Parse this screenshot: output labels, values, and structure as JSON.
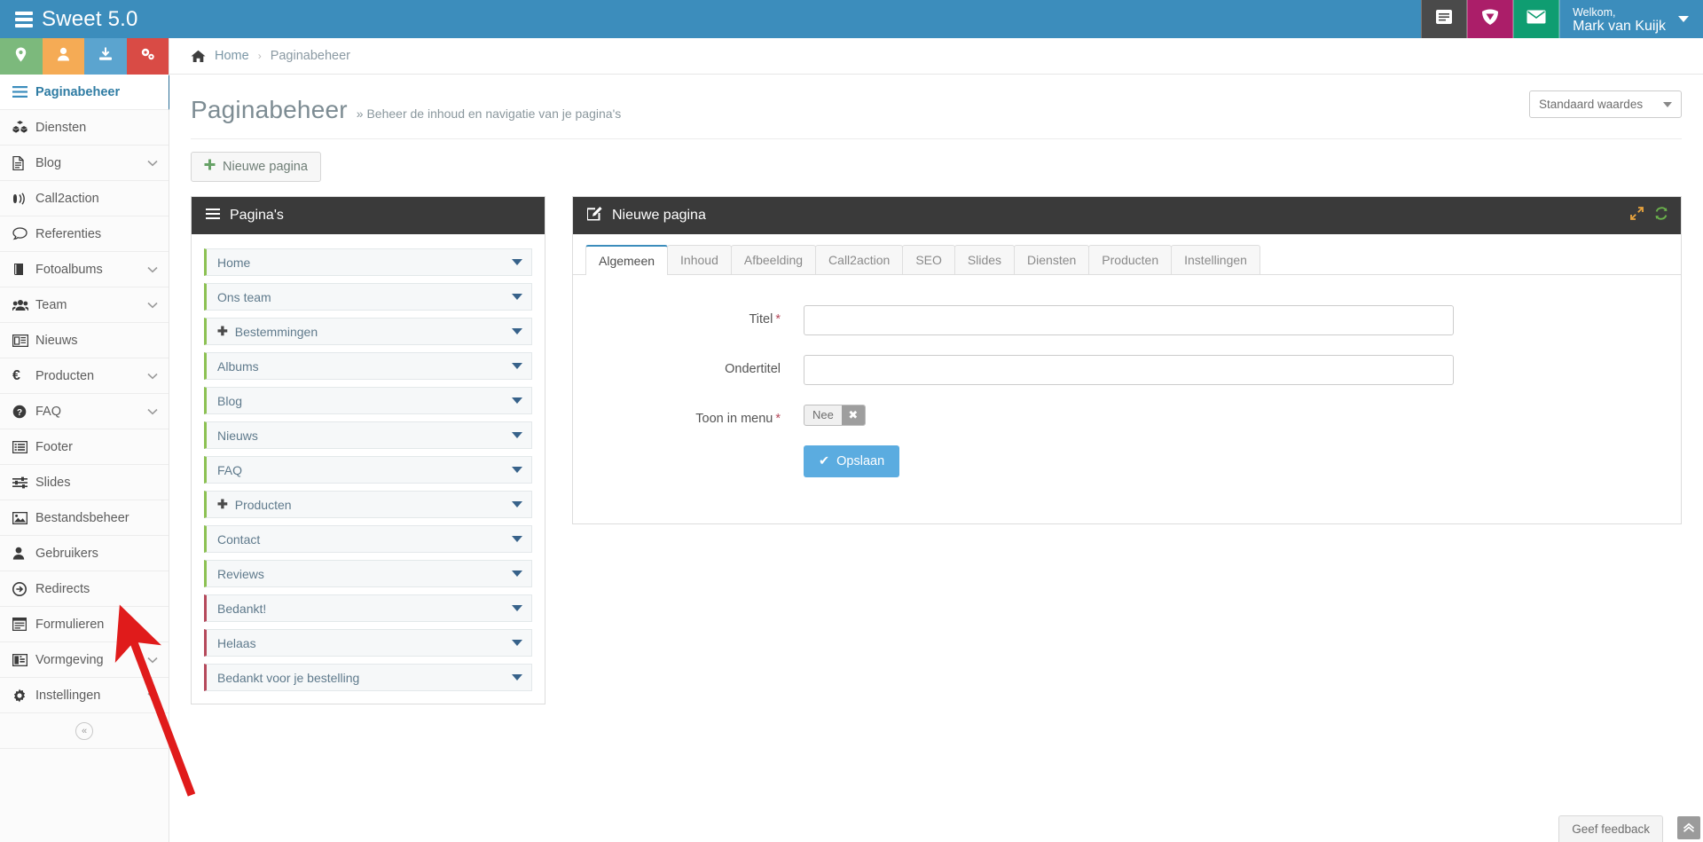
{
  "topbar": {
    "brand": "Sweet 5.0",
    "brand_icon": "server-stack-icon",
    "actions": [
      {
        "name": "list-icon",
        "glyph": "☰"
      },
      {
        "name": "diamond-superhero-icon",
        "glyph": "◇"
      },
      {
        "name": "envelope-icon",
        "glyph": "✉"
      }
    ],
    "user": {
      "greeting": "Welkom,",
      "name": "Mark van Kuijk"
    }
  },
  "quickbar": [
    {
      "name": "map-marker-icon",
      "glyph": "⌘",
      "color": "#7cb97c"
    },
    {
      "name": "user-icon",
      "glyph": "☺",
      "color": "#f5ab55"
    },
    {
      "name": "download-icon",
      "glyph": "⤓",
      "color": "#5ba4cf"
    },
    {
      "name": "cogs-icon",
      "glyph": "⚙",
      "color": "#d94b45"
    }
  ],
  "sidebar": {
    "items": [
      {
        "label": "Paginabeheer",
        "icon": "bars-icon",
        "active": true,
        "chevron": false
      },
      {
        "label": "Diensten",
        "icon": "cubes-icon",
        "active": false,
        "chevron": false
      },
      {
        "label": "Blog",
        "icon": "file-text-icon",
        "active": false,
        "chevron": true
      },
      {
        "label": "Call2action",
        "icon": "bullhorn-icon",
        "active": false,
        "chevron": false
      },
      {
        "label": "Referenties",
        "icon": "comment-icon",
        "active": false,
        "chevron": false
      },
      {
        "label": "Fotoalbums",
        "icon": "book-icon",
        "active": false,
        "chevron": true
      },
      {
        "label": "Team",
        "icon": "users-icon",
        "active": false,
        "chevron": true
      },
      {
        "label": "Nieuws",
        "icon": "newspaper-icon",
        "active": false,
        "chevron": false
      },
      {
        "label": "Producten",
        "icon": "euro-icon",
        "active": false,
        "chevron": true
      },
      {
        "label": "FAQ",
        "icon": "question-circle-icon",
        "active": false,
        "chevron": true
      },
      {
        "label": "Footer",
        "icon": "list-alt-icon",
        "active": false,
        "chevron": false
      },
      {
        "label": "Slides",
        "icon": "sliders-icon",
        "active": false,
        "chevron": false
      },
      {
        "label": "Bestandsbeheer",
        "icon": "image-icon",
        "active": false,
        "chevron": false
      },
      {
        "label": "Gebruikers",
        "icon": "user-icon",
        "active": false,
        "chevron": false
      },
      {
        "label": "Redirects",
        "icon": "arrow-circle-right-icon",
        "active": false,
        "chevron": false
      },
      {
        "label": "Formulieren",
        "icon": "form-icon",
        "active": false,
        "chevron": false
      },
      {
        "label": "Vormgeving",
        "icon": "columns-icon",
        "active": false,
        "chevron": true
      },
      {
        "label": "Instellingen",
        "icon": "gear-icon",
        "active": false,
        "chevron": true
      }
    ],
    "collapse_glyph": "«"
  },
  "breadcrumb": {
    "home": "Home",
    "separator": "›",
    "current": "Paginabeheer"
  },
  "pagehead": {
    "title": "Paginabeheer",
    "subtitle": "» Beheer de inhoud en navigatie van je pagina's",
    "select_value": "Standaard waardes"
  },
  "toolbar": {
    "new_page_label": "Nieuwe pagina",
    "new_page_plus": "＋"
  },
  "pages_panel": {
    "title": "Pagina's",
    "icon": "bars-icon",
    "items": [
      {
        "label": "Home",
        "color": "green",
        "plus": false
      },
      {
        "label": "Ons team",
        "color": "green",
        "plus": false
      },
      {
        "label": "Bestemmingen",
        "color": "green",
        "plus": true
      },
      {
        "label": "Albums",
        "color": "green",
        "plus": false
      },
      {
        "label": "Blog",
        "color": "green",
        "plus": false
      },
      {
        "label": "Nieuws",
        "color": "green",
        "plus": false
      },
      {
        "label": "FAQ",
        "color": "green",
        "plus": false
      },
      {
        "label": "Producten",
        "color": "green",
        "plus": true
      },
      {
        "label": "Contact",
        "color": "green",
        "plus": false
      },
      {
        "label": "Reviews",
        "color": "green",
        "plus": false
      },
      {
        "label": "Bedankt!",
        "color": "red",
        "plus": false
      },
      {
        "label": "Helaas",
        "color": "red",
        "plus": false
      },
      {
        "label": "Bedankt voor je bestelling",
        "color": "red",
        "plus": false
      }
    ]
  },
  "editor_panel": {
    "title": "Nieuwe pagina",
    "icon": "pencil-square-icon",
    "header_icons": [
      {
        "name": "expand-icon",
        "glyph": "⤡",
        "color": "#e8a33d"
      },
      {
        "name": "refresh-icon",
        "glyph": "↻",
        "color": "#6ab04c"
      }
    ],
    "tabs": [
      {
        "label": "Algemeen",
        "active": true
      },
      {
        "label": "Inhoud",
        "active": false
      },
      {
        "label": "Afbeelding",
        "active": false
      },
      {
        "label": "Call2action",
        "active": false
      },
      {
        "label": "SEO",
        "active": false
      },
      {
        "label": "Slides",
        "active": false
      },
      {
        "label": "Diensten",
        "active": false
      },
      {
        "label": "Producten",
        "active": false
      },
      {
        "label": "Instellingen",
        "active": false
      }
    ],
    "form": {
      "titel_label": "Titel",
      "titel_value": "",
      "titel_placeholder": "",
      "ondertitel_label": "Ondertitel",
      "ondertitel_value": "",
      "ondertitel_placeholder": "",
      "toon_label": "Toon in menu",
      "toon_value": "Nee",
      "toon_knob_glyph": "✖",
      "required_mark": "*",
      "save_label": "Opslaan",
      "save_check": "✔"
    }
  },
  "footer": {
    "feedback_label": "Geef feedback",
    "scroll_top_glyph": "⌃"
  },
  "colors": {
    "brand_blue": "#3c8dbc",
    "panel_dark": "#3a3a3a",
    "accent_green": "#8cc152",
    "accent_red": "#b5495b",
    "save_blue": "#5bace0",
    "annotation_red": "#e01b1b"
  }
}
